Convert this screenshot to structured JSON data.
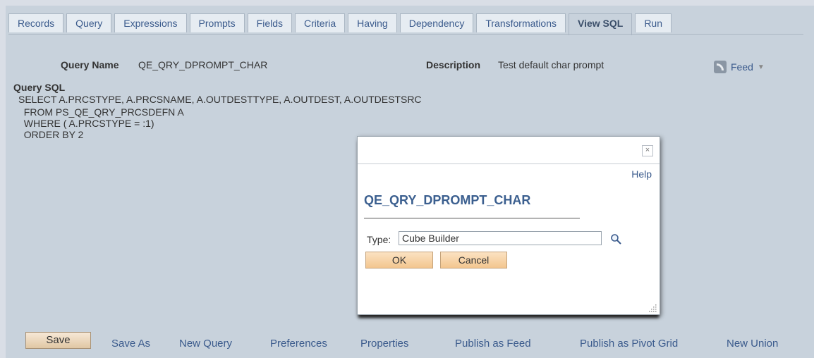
{
  "tabs": [
    {
      "label": "Records"
    },
    {
      "label": "Query"
    },
    {
      "label": "Expressions"
    },
    {
      "label": "Prompts"
    },
    {
      "label": "Fields"
    },
    {
      "label": "Criteria"
    },
    {
      "label": "Having"
    },
    {
      "label": "Dependency"
    },
    {
      "label": "Transformations"
    },
    {
      "label": "View SQL"
    },
    {
      "label": "Run"
    }
  ],
  "active_tab": "View SQL",
  "query": {
    "name_label": "Query Name",
    "name": "QE_QRY_DPROMPT_CHAR",
    "description_label": "Description",
    "description": "Test default char prompt",
    "feed_label": "Feed",
    "sql_label": "Query SQL",
    "sql_lines": [
      "SELECT A.PRCSTYPE, A.PRCSNAME, A.OUTDESTTYPE, A.OUTDEST, A.OUTDESTSRC",
      "  FROM PS_QE_QRY_PRCSDEFN A",
      "  WHERE ( A.PRCSTYPE = :1)",
      "  ORDER BY 2"
    ]
  },
  "modal": {
    "close_symbol": "×",
    "help_label": "Help",
    "title": "QE_QRY_DPROMPT_CHAR",
    "type_label": "Type:",
    "type_value": "Cube Builder",
    "ok_label": "OK",
    "cancel_label": "Cancel"
  },
  "footer": {
    "save": "Save",
    "save_as": "Save As",
    "new_query": "New Query",
    "preferences": "Preferences",
    "properties": "Properties",
    "publish_feed": "Publish as Feed",
    "publish_pivot": "Publish as Pivot Grid",
    "new_union": "New Union"
  },
  "colors": {
    "accent": "#3a5a8c",
    "background": "#c8d2dc",
    "button": "#f3c68f"
  }
}
